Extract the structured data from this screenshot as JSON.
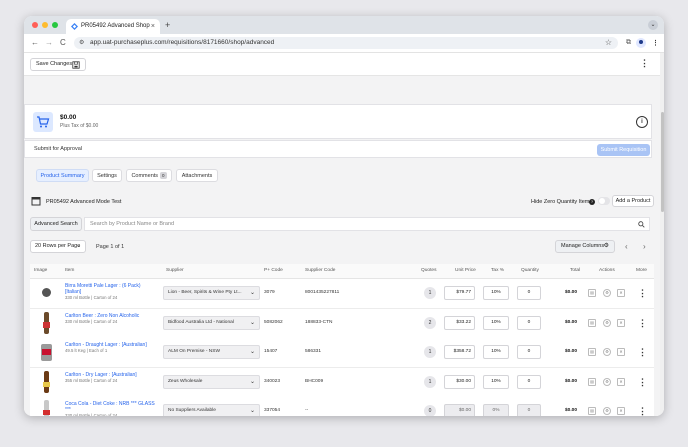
{
  "browser": {
    "tab_title": "PR05492 Advanced Shop",
    "tab_close": "×",
    "new_tab": "+",
    "url": "app.uat-purchaseplus.com/requisitions/8171660/shop/advanced",
    "nav_back": "←",
    "nav_forward": "→",
    "nav_reload": "C",
    "colors": {
      "close": "#ff5f57",
      "minimize": "#febc2e",
      "maximize": "#28c840"
    }
  },
  "page": {
    "save_changes_label": "Save Changes",
    "summary": {
      "total": "$0.00",
      "tax": "Plus Tax of $0.00",
      "info_icon": "i"
    },
    "approval": {
      "label": "Submit for Approval",
      "submit_button": "Submit Requisition"
    },
    "tabs": [
      {
        "label": "Product Summary",
        "active": true
      },
      {
        "label": "Settings",
        "active": false
      },
      {
        "label": "Comments",
        "badge": "0",
        "active": false
      },
      {
        "label": "Attachments",
        "active": false
      }
    ],
    "shop": {
      "title": "PR05492 Advanced Mode Test",
      "hide_zero_label": "Hide Zero Quantity Items",
      "add_product_label": "Add a Product",
      "advanced_search_label": "Advanced Search",
      "search_placeholder": "Search by Product Name or Brand",
      "rows_per_page": "20 Rows per Page",
      "page_info": "Page 1 of 1",
      "manage_columns_label": "Manage Columns"
    },
    "table": {
      "headers": [
        "Image",
        "Item",
        "Supplier",
        "P+ Code",
        "Supplier Code",
        "Quotes",
        "Unit Price",
        "Tax %",
        "Quantity",
        "Total",
        "Actions",
        "More"
      ],
      "rows": [
        {
          "name_line1": "Birra Moretti Pale Lager : (6 Pack)",
          "name_line2": "[Italian]",
          "desc": "330 ml Bottle | Carton of 24",
          "supplier": "Lion - Beer, Spirits & Wine Pty Lt...",
          "pcode": "3079",
          "supplier_code": "8001435227811",
          "quotes": "1",
          "unit_price": "$79.77",
          "tax": "10%",
          "quantity": "0",
          "total": "$0.00",
          "disabled": false
        },
        {
          "name_line1": "Carlton Beer : Zero Non Alcoholic",
          "name_line2": "",
          "desc": "330 ml Bottle | Carton of 24",
          "supplier": "Bidfood Australia Ltd - National",
          "pcode": "5082062",
          "supplier_code": "188833-CTN",
          "quotes": "2",
          "unit_price": "$33.22",
          "tax": "10%",
          "quantity": "0",
          "total": "$0.00",
          "disabled": false
        },
        {
          "name_line1": "Carlton - Draught Lager : [Australian]",
          "name_line2": "",
          "desc": "49.5 lt Keg | Each of 1",
          "supplier": "ALM On Premise - NSW",
          "pcode": "15407",
          "supplier_code": "586331",
          "quotes": "1",
          "unit_price": "$358.72",
          "tax": "10%",
          "quantity": "0",
          "total": "$0.00",
          "disabled": false
        },
        {
          "name_line1": "Carlton - Dry Lager : [Australian]",
          "name_line2": "",
          "desc": "355 ml Bottle | Carton of 24",
          "supplier": "Zeus Wholesale",
          "pcode": "340023",
          "supplier_code": "BHC009",
          "quotes": "1",
          "unit_price": "$30.00",
          "tax": "10%",
          "quantity": "0",
          "total": "$0.00",
          "disabled": false
        },
        {
          "name_line1": "Coca Cola - Diet Coke : NRB *** GLASS",
          "name_line2": "***",
          "desc": "330 ml Bottle | Carton of 24",
          "supplier": "No Suppliers Available",
          "pcode": "337054",
          "supplier_code": "--",
          "quotes": "0",
          "unit_price": "$0.00",
          "tax": "0%",
          "quantity": "0",
          "total": "$0.00",
          "disabled": true
        }
      ]
    }
  }
}
